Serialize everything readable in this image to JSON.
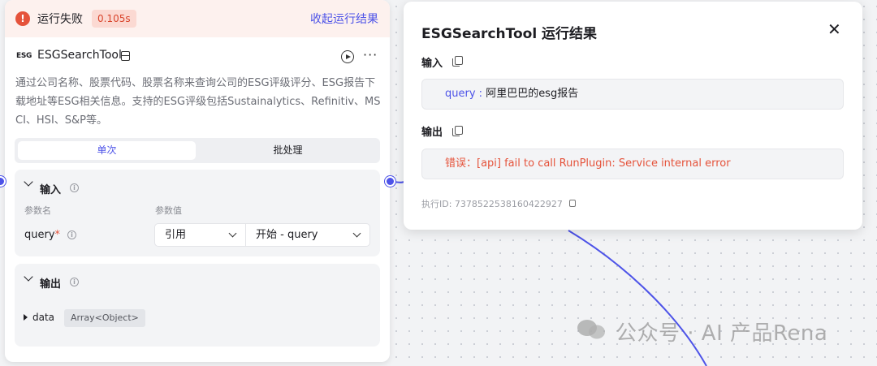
{
  "status": {
    "text": "运行失败",
    "duration": "0.105s",
    "collapse_label": "收起运行结果"
  },
  "tool": {
    "logo": "ESG",
    "name": "ESGSearchTool",
    "description": "通过公司名称、股票代码、股票名称来查询公司的ESG评级评分、ESG报告下载地址等ESG相关信息。支持的ESG评级包括Sustainalytics、Refinitiv、MSCI、HSI、S&P等。"
  },
  "tabs": [
    {
      "label": "单次",
      "active": true
    },
    {
      "label": "批处理",
      "active": false
    }
  ],
  "input_section": {
    "title": "输入",
    "col_name": "参数名",
    "col_value": "参数值",
    "param_name": "query",
    "required_mark": "*",
    "ref_type": "引用",
    "ref_value": "开始 - query"
  },
  "output_section": {
    "title": "输出",
    "field_name": "data",
    "field_type": "Array<Object>"
  },
  "result_panel": {
    "title": "ESGSearchTool 运行结果",
    "input_label": "输入",
    "query_key": "query",
    "query_sep": " : ",
    "query_value": "阿里巴巴的esg报告",
    "output_label": "输出",
    "error_text": "错误：[api] fail to call RunPlugin: Service internal error",
    "exec_id": "执行ID: 7378522538160422927"
  },
  "watermark": {
    "text": "公众号 · AI 产品Rena"
  },
  "colors": {
    "accent": "#4d53e8",
    "error": "#e5533b",
    "error_bg": "#fdf1ee"
  },
  "icons": [
    "error-icon",
    "layout-icon",
    "play-icon",
    "more-icon",
    "info-icon",
    "copy-icon",
    "close-icon",
    "wechat-icon"
  ]
}
